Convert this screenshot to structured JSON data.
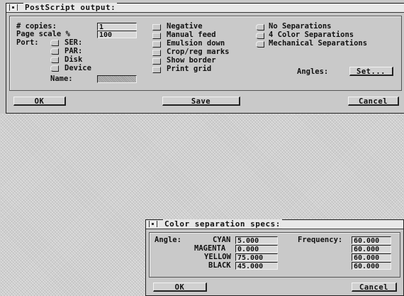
{
  "postscript": {
    "title": "PostScript output:",
    "copies_label": "# copies:",
    "copies_value": "1",
    "scale_label": "Page scale %",
    "scale_value": "100",
    "port_label": "Port:",
    "ports": [
      "SER:",
      "PAR:",
      "Disk",
      "Device"
    ],
    "name_label": "Name:",
    "name_value": "",
    "options": [
      "Negative",
      "Manual feed",
      "Emulsion down",
      "Crop/reg marks",
      "Show border",
      "Print grid"
    ],
    "separations": [
      "No Separations",
      "4 Color Separations",
      "Mechanical Separations"
    ],
    "angles_label": "Angles:",
    "set_button": "Set...",
    "ok_button": "OK",
    "save_button": "Save",
    "cancel_button": "Cancel"
  },
  "color_sep": {
    "title": "Color separation specs:",
    "angle_label": "Angle:",
    "frequency_label": "Frequency:",
    "rows": [
      {
        "name": "CYAN",
        "angle": "5.000",
        "frequency": "60.000"
      },
      {
        "name": "MAGENTA",
        "angle": "0.000",
        "frequency": "60.000"
      },
      {
        "name": "YELLOW",
        "angle": "75.000",
        "frequency": "60.000"
      },
      {
        "name": "BLACK",
        "angle": "45.000",
        "frequency": "60.000"
      }
    ],
    "ok_button": "OK",
    "cancel_button": "Cancel"
  }
}
